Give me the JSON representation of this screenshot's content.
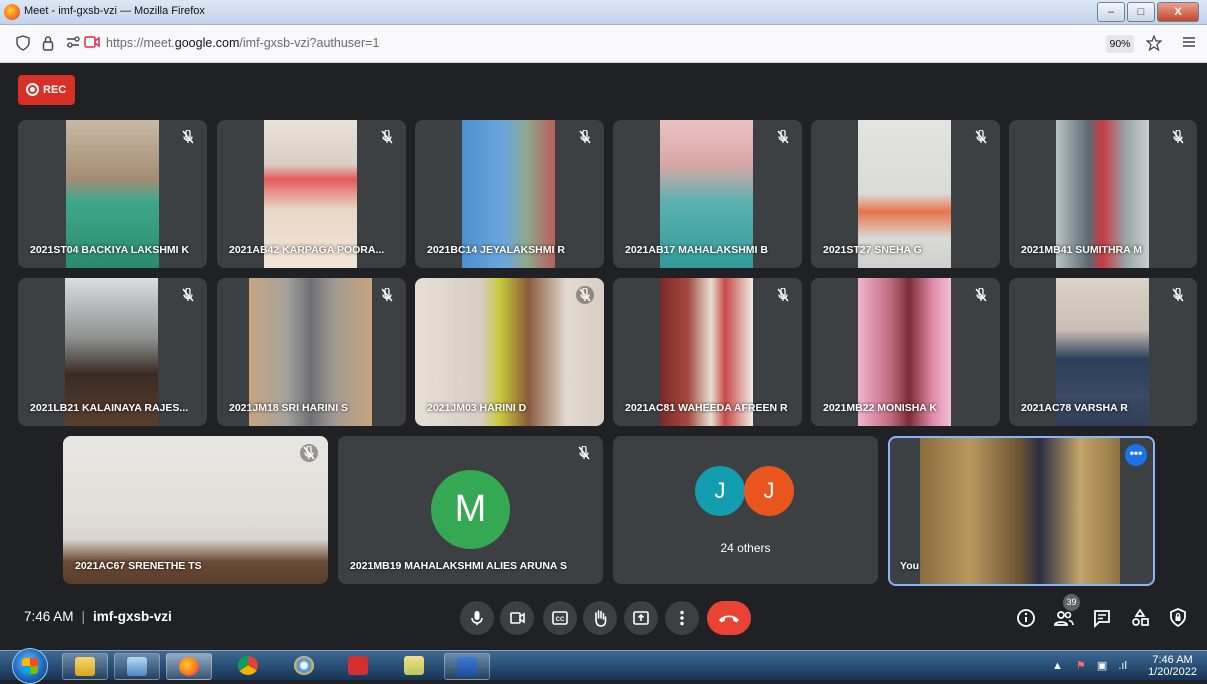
{
  "window": {
    "title": "Meet - imf-gxsb-vzi — Mozilla Firefox",
    "minimize": "–",
    "maximize": "□",
    "close": "X"
  },
  "urlbar": {
    "url_prefix": "https://meet.",
    "url_domain": "google.com",
    "url_path": "/imf-gxsb-vzi?authuser=1",
    "zoom": "90%"
  },
  "meet": {
    "rec_label": "REC",
    "tiles": [
      {
        "name": "2021ST04 BACKIYA LAKSHMI K",
        "muted": true
      },
      {
        "name": "2021AB42 KARPAGA POORA...",
        "muted": true
      },
      {
        "name": "2021BC14 JEYALAKSHMI R",
        "muted": true
      },
      {
        "name": "2021AB17 MAHALAKSHMI B",
        "muted": true
      },
      {
        "name": "2021ST27 SNEHA G",
        "muted": true
      },
      {
        "name": "2021MB41 SUMITHRA M",
        "muted": true
      },
      {
        "name": "2021LB21 KALAINAYA RAJES...",
        "muted": true
      },
      {
        "name": "2021JM18 SRI HARINI S",
        "muted": true
      },
      {
        "name": "2021JM03 HARINI D",
        "muted": true
      },
      {
        "name": "2021AC81 WAHEEDA AFREEN R",
        "muted": true
      },
      {
        "name": "2021MB22 MONISHA K",
        "muted": true
      },
      {
        "name": "2021AC78 VARSHA R",
        "muted": true
      },
      {
        "name": "2021AC67 SRENETHE TS",
        "muted": true
      },
      {
        "name": "2021MB19 MAHALAKSHMI ALIES ARUNA S",
        "muted": true,
        "avatar_letter": "M",
        "avatar_color": "#34a853"
      }
    ],
    "others": {
      "avatars": [
        {
          "letter": "J",
          "color": "#129eaf"
        },
        {
          "letter": "J",
          "color": "#e8561d"
        }
      ],
      "label": "24 others"
    },
    "self": {
      "name": "You"
    },
    "bottom": {
      "time": "7:46 AM",
      "meeting_code": "imf-gxsb-vzi",
      "participants_count": "39"
    }
  },
  "taskbar": {
    "time": "7:46 AM",
    "date": "1/20/2022"
  },
  "colors": {
    "end_call": "#ea4335",
    "rec": "#d93025",
    "self_border": "#8ab4f8"
  }
}
